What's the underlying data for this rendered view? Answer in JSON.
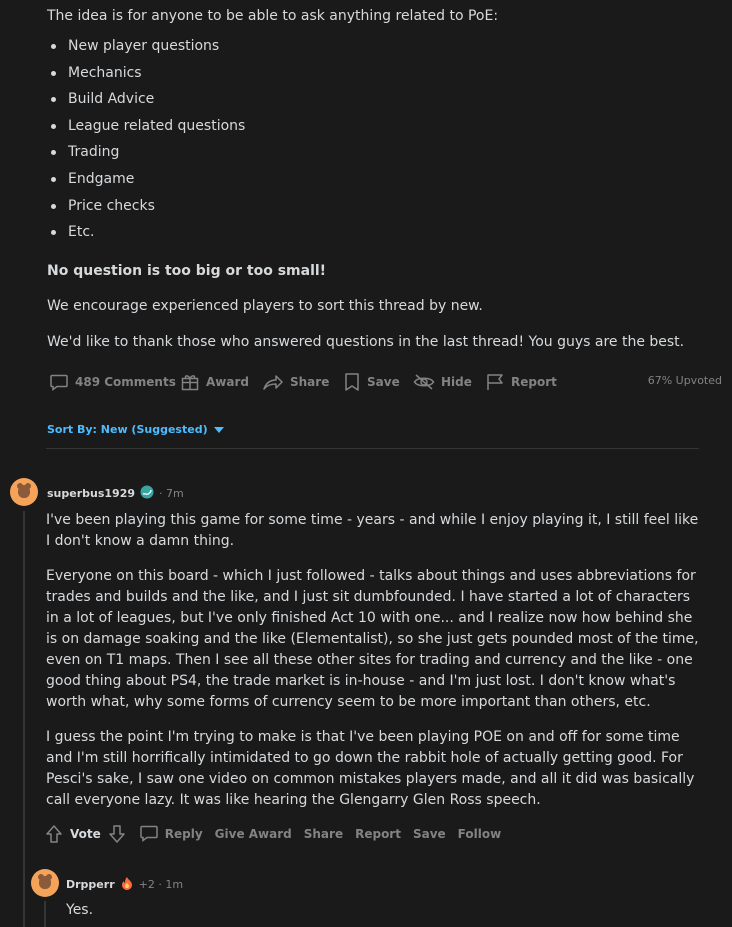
{
  "post": {
    "intro": "The idea is for anyone to be able to ask anything related to PoE:",
    "bullets": [
      "New player questions",
      "Mechanics",
      "Build Advice",
      "League related questions",
      "Trading",
      "Endgame",
      "Price checks",
      "Etc."
    ],
    "bold_line": "No question is too big or too small!",
    "encourage": "We encourage experienced players to sort this thread by new.",
    "thanks": "We'd like to thank those who answered questions in the last thread! You guys are the best."
  },
  "post_actions": {
    "comments": "489 Comments",
    "award": "Award",
    "share": "Share",
    "save": "Save",
    "hide": "Hide",
    "report": "Report",
    "upvoted": "67% Upvoted"
  },
  "sort": {
    "label": "Sort By: New (Suggested)"
  },
  "comments": [
    {
      "user": "superbus1929",
      "time": "· 7m",
      "paragraphs": [
        "I've been playing this game for some time - years - and while I enjoy playing it, I still feel like I don't know a damn thing.",
        "Everyone on this board - which I just followed - talks about things and uses abbreviations for trades and builds and the like, and I just sit dumbfounded. I have started a lot of characters in a lot of leagues, but I've only finished Act 10 with one... and I realize now how behind she is on damage soaking and the like (Elementalist), so she just gets pounded most of the time, even on T1 maps. Then I see all these other sites for trading and currency and the like - one good thing about PS4, the trade market is in-house - and I'm just lost. I don't know what's worth what, why some forms of currency seem to be more important than others, etc.",
        "I guess the point I'm trying to make is that I've been playing POE on and off for some time and I'm still horrifically intimidated to go down the rabbit hole of actually getting good. For Pesci's sake, I saw one video on common mistakes players made, and all it did was basically call everyone lazy. It was like hearing the Glengarry Glen Ross speech."
      ],
      "actions": {
        "vote": "Vote",
        "reply": "Reply",
        "give_award": "Give Award",
        "share": "Share",
        "report": "Report",
        "save": "Save",
        "follow": "Follow"
      }
    },
    {
      "user": "Drpperr",
      "time": "+2 · 1m",
      "paragraphs": [
        "Yes."
      ]
    }
  ],
  "colors": {
    "background": "#1a1a1b",
    "text": "#d7dadc",
    "muted": "#818384",
    "accent": "#4fbcff",
    "avatar": "#f6a35a"
  }
}
